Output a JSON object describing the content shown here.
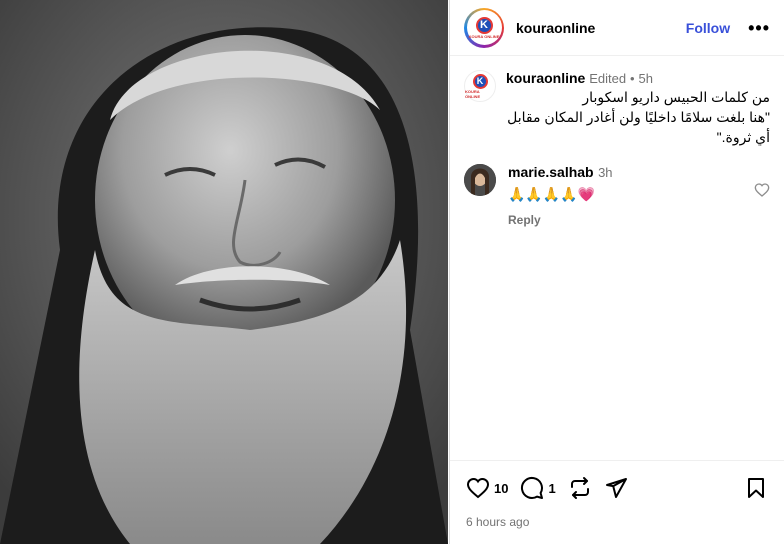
{
  "post": {
    "image_alt": "Black and white portrait of an elderly bearded man",
    "author": {
      "username": "kouraonline",
      "logo_letter": "K",
      "logo_text": "KOURA ONLINE"
    },
    "header": {
      "follow_label": "Follow",
      "more_label": "•••"
    },
    "caption": {
      "username": "kouraonline",
      "edited": "Edited",
      "separator": "•",
      "age": "5h",
      "line1": "من كلمات الحبيس داريو اسكوبار",
      "line2": "\"هنا بلغت سلامًا داخليًا ولن أغادر المكان مقابل",
      "line3": "أي ثروة.\""
    },
    "comments": [
      {
        "username": "marie.salhab",
        "age": "3h",
        "text": "🙏🙏🙏🙏💗",
        "reply_label": "Reply"
      }
    ],
    "stats": {
      "likes": "10",
      "comments": "1"
    },
    "timestamp": "6 hours ago"
  },
  "colors": {
    "follow": "#3950d9",
    "muted": "#737373",
    "divider": "#dbdbdb"
  }
}
